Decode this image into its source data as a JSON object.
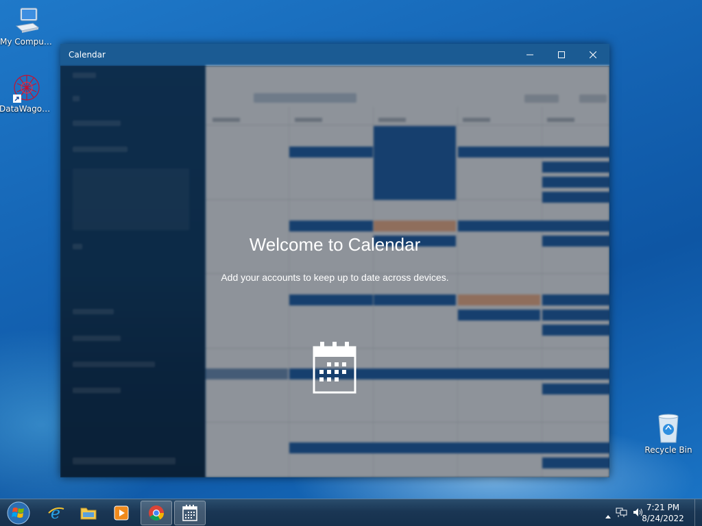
{
  "desktop": {
    "icons": [
      {
        "label": "My Computer",
        "icon": "computer-icon"
      },
      {
        "label": "DataWagon...",
        "icon": "datawagon-icon"
      },
      {
        "label": "Recycle Bin",
        "icon": "recycle-bin-icon"
      }
    ]
  },
  "window": {
    "title": "Calendar",
    "controls": {
      "minimize": "minimize-icon",
      "maximize": "maximize-icon",
      "close": "close-icon"
    },
    "welcome": {
      "title": "Welcome to Calendar",
      "subtitle": "Add your accounts to keep up to date across devices.",
      "icon": "calendar-icon"
    }
  },
  "taskbar": {
    "start": "windows-start-icon",
    "pinned": [
      {
        "name": "internet-explorer",
        "icon": "ie-icon"
      },
      {
        "name": "file-explorer",
        "icon": "folder-icon"
      },
      {
        "name": "media-player",
        "icon": "media-player-icon"
      },
      {
        "name": "chrome",
        "icon": "chrome-icon"
      },
      {
        "name": "calendar",
        "icon": "calendar-icon",
        "active": true
      }
    ],
    "tray": {
      "time": "7:21 PM",
      "date": "8/24/2022",
      "icons": [
        "show-hidden-icons",
        "network-icon",
        "volume-icon"
      ]
    }
  },
  "colors": {
    "accent": "#1b5b93",
    "event": "#1f5fa8",
    "event_orange": "#f0b089"
  }
}
